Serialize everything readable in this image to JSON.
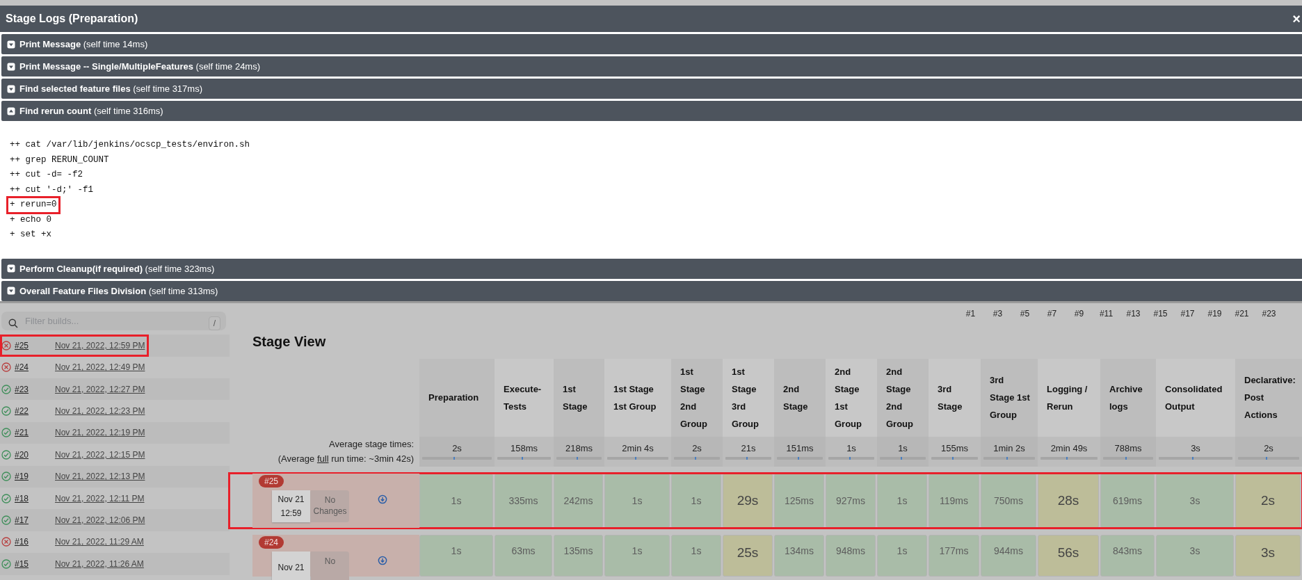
{
  "modal": {
    "title": "Stage Logs (Preparation)",
    "close_glyph": "×",
    "sections": [
      {
        "title": "Print Message",
        "self_time": "(self time 14ms)",
        "expanded": false
      },
      {
        "title": "Print Message -- Single/MultipleFeatures",
        "self_time": "(self time 24ms)",
        "expanded": false
      },
      {
        "title": "Find selected feature files",
        "self_time": "(self time 317ms)",
        "expanded": false
      },
      {
        "title": "Find rerun count",
        "self_time": "(self time 316ms)",
        "expanded": true,
        "log_lines": [
          {
            "text": "++ cat /var/lib/jenkins/ocscp_tests/environ.sh",
            "highlighted": false
          },
          {
            "text": "++ grep RERUN_COUNT",
            "highlighted": false
          },
          {
            "text": "++ cut -d= -f2",
            "highlighted": false
          },
          {
            "text": "++ cut '-d;' -f1",
            "highlighted": false
          },
          {
            "text": "+ rerun=0",
            "highlighted": true
          },
          {
            "text": "+ echo 0",
            "highlighted": false
          },
          {
            "text": "+ set +x",
            "highlighted": false
          }
        ]
      },
      {
        "title": "Perform Cleanup(if required)",
        "self_time": "(self time 323ms)",
        "expanded": false
      },
      {
        "title": "Overall Feature Files Division",
        "self_time": "(self time 313ms)",
        "expanded": false
      }
    ]
  },
  "sidebar": {
    "filter": {
      "placeholder": "Filter builds...",
      "shortcut": "/"
    },
    "builds": [
      {
        "number": "#25",
        "date": "Nov 21, 2022, 12:59 PM",
        "kind": "failed",
        "highlighted": true
      },
      {
        "number": "#24",
        "date": "Nov 21, 2022, 12:49 PM",
        "kind": "failed",
        "highlighted": false
      },
      {
        "number": "#23",
        "date": "Nov 21, 2022, 12:27 PM",
        "kind": "success",
        "highlighted": false
      },
      {
        "number": "#22",
        "date": "Nov 21, 2022, 12:23 PM",
        "kind": "success",
        "highlighted": false
      },
      {
        "number": "#21",
        "date": "Nov 21, 2022, 12:19 PM",
        "kind": "success",
        "highlighted": false
      },
      {
        "number": "#20",
        "date": "Nov 21, 2022, 12:15 PM",
        "kind": "success",
        "highlighted": false
      },
      {
        "number": "#19",
        "date": "Nov 21, 2022, 12:13 PM",
        "kind": "success",
        "highlighted": false
      },
      {
        "number": "#18",
        "date": "Nov 21, 2022, 12:11 PM",
        "kind": "success",
        "highlighted": false
      },
      {
        "number": "#17",
        "date": "Nov 21, 2022, 12:06 PM",
        "kind": "success",
        "highlighted": false
      },
      {
        "number": "#16",
        "date": "Nov 21, 2022, 11:29 AM",
        "kind": "failed",
        "highlighted": false
      },
      {
        "number": "#15",
        "date": "Nov 21, 2022, 11:26 AM",
        "kind": "success",
        "highlighted": false
      }
    ]
  },
  "stage_view": {
    "trend_axis_labels": [
      "#1",
      "#3",
      "#5",
      "#7",
      "#9",
      "#11",
      "#13",
      "#15",
      "#17",
      "#19",
      "#21",
      "#23"
    ],
    "title": "Stage View",
    "average_label": "Average stage times:",
    "average_full": {
      "prefix": "(Average ",
      "link": "full",
      "suffix": " run time: ~3min 42s)"
    },
    "columns": [
      {
        "name": "Preparation",
        "average": "2s"
      },
      {
        "name": "Execute-Tests",
        "average": "158ms"
      },
      {
        "name": "1st Stage",
        "average": "218ms"
      },
      {
        "name": "1st Stage 1st Group",
        "average": "2min 4s"
      },
      {
        "name": "1st Stage 2nd Group",
        "average": "2s"
      },
      {
        "name": "1st Stage 3rd Group",
        "average": "21s"
      },
      {
        "name": "2nd Stage",
        "average": "151ms"
      },
      {
        "name": "2nd Stage 1st Group",
        "average": "1s"
      },
      {
        "name": "2nd Stage 2nd Group",
        "average": "1s"
      },
      {
        "name": "3rd Stage",
        "average": "155ms"
      },
      {
        "name": "3rd Stage 1st Group",
        "average": "1min 2s"
      },
      {
        "name": "Logging / Rerun",
        "average": "2min 49s"
      },
      {
        "name": "Archive logs",
        "average": "788ms"
      },
      {
        "name": "Consolidated Output",
        "average": "3s"
      },
      {
        "name": "Declarative: Post Actions",
        "average": "2s"
      }
    ],
    "runs": [
      {
        "number": "#25",
        "date": "Nov 21",
        "time": "12:59",
        "changes": "No Changes",
        "highlighted": true,
        "cells": [
          {
            "text": "1s",
            "kind": "success"
          },
          {
            "text": "335ms",
            "kind": "success"
          },
          {
            "text": "242ms",
            "kind": "success"
          },
          {
            "text": "1s",
            "kind": "success"
          },
          {
            "text": "1s",
            "kind": "success"
          },
          {
            "text": "29s",
            "kind": "unstable"
          },
          {
            "text": "125ms",
            "kind": "success"
          },
          {
            "text": "927ms",
            "kind": "success"
          },
          {
            "text": "1s",
            "kind": "success"
          },
          {
            "text": "119ms",
            "kind": "success"
          },
          {
            "text": "750ms",
            "kind": "success"
          },
          {
            "text": "28s",
            "kind": "unstable"
          },
          {
            "text": "619ms",
            "kind": "success"
          },
          {
            "text": "3s",
            "kind": "success"
          },
          {
            "text": "2s",
            "kind": "unstable"
          }
        ]
      },
      {
        "number": "#24",
        "date": "Nov 21",
        "changes": "No",
        "highlighted": false,
        "cells": [
          {
            "text": "1s",
            "kind": "success"
          },
          {
            "text": "63ms",
            "kind": "success"
          },
          {
            "text": "135ms",
            "kind": "success"
          },
          {
            "text": "1s",
            "kind": "success"
          },
          {
            "text": "1s",
            "kind": "success"
          },
          {
            "text": "25s",
            "kind": "unstable"
          },
          {
            "text": "134ms",
            "kind": "success"
          },
          {
            "text": "948ms",
            "kind": "success"
          },
          {
            "text": "1s",
            "kind": "success"
          },
          {
            "text": "177ms",
            "kind": "success"
          },
          {
            "text": "944ms",
            "kind": "success"
          },
          {
            "text": "56s",
            "kind": "unstable"
          },
          {
            "text": "843ms",
            "kind": "success"
          },
          {
            "text": "3s",
            "kind": "success"
          },
          {
            "text": "3s",
            "kind": "unstable"
          }
        ]
      }
    ]
  }
}
